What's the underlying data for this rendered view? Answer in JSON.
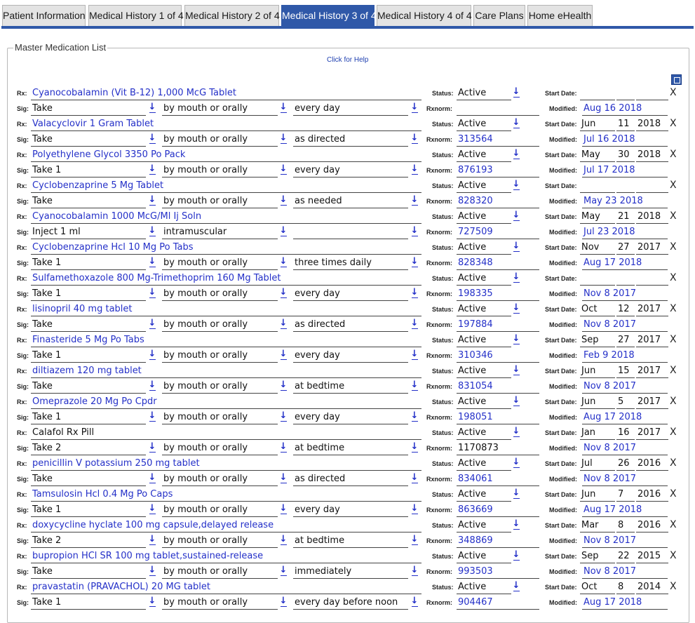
{
  "tabs": [
    {
      "label": "Patient Information",
      "active": false
    },
    {
      "label": "Medical History 1 of 4",
      "active": false
    },
    {
      "label": "Medical History 2 of 4",
      "active": false
    },
    {
      "label": "Medical History 3 of 4",
      "active": true
    },
    {
      "label": "Medical History 4 of 4",
      "active": false
    },
    {
      "label": "Care Plans",
      "active": false
    },
    {
      "label": "Home eHealth",
      "active": false
    }
  ],
  "panel": {
    "title": "Master Medication List",
    "help": "Click for Help"
  },
  "labels": {
    "rx": "Rx:",
    "sig": "Sig:",
    "status": "Status:",
    "rxnorm": "Rxnorm:",
    "start": "Start Date:",
    "modified": "Modified:",
    "remove": "X",
    "dropdown_icon": "down-arrow-icon"
  },
  "medications": [
    {
      "name": "Cyanocobalamin (Vit B-12) 1,000 McG Tablet",
      "linked": true,
      "sig_dose": "Take",
      "sig_route": "by mouth or orally",
      "sig_freq": "every day",
      "status": "Active",
      "rxnorm": "",
      "start_month": "",
      "start_day": "",
      "start_year": "",
      "modified": "Aug 16 2018"
    },
    {
      "name": "Valacyclovir 1 Gram Tablet",
      "linked": true,
      "sig_dose": "Take",
      "sig_route": "by mouth or orally",
      "sig_freq": "as directed",
      "status": "Active",
      "rxnorm": "313564",
      "start_month": "Jun",
      "start_day": "11",
      "start_year": "2018",
      "modified": "Jul 16 2018"
    },
    {
      "name": "Polyethylene Glycol 3350 Po Pack",
      "linked": true,
      "sig_dose": "Take 1",
      "sig_route": "by mouth or orally",
      "sig_freq": "every day",
      "status": "Active",
      "rxnorm": "876193",
      "start_month": "May",
      "start_day": "30",
      "start_year": "2018",
      "modified": "Jul 17 2018"
    },
    {
      "name": "Cyclobenzaprine 5 Mg Tablet",
      "linked": true,
      "sig_dose": "Take",
      "sig_route": "by mouth or orally",
      "sig_freq": "as needed",
      "status": "Active",
      "rxnorm": "828320",
      "start_month": "",
      "start_day": "",
      "start_year": "",
      "modified": "May 23 2018"
    },
    {
      "name": "Cyanocobalamin 1000 McG/Ml Ij Soln",
      "linked": true,
      "sig_dose": "Inject 1 ml",
      "sig_route": "intramuscular",
      "sig_freq": "",
      "status": "Active",
      "rxnorm": "727509",
      "start_month": "May",
      "start_day": "21",
      "start_year": "2018",
      "modified": "Jul 23 2018"
    },
    {
      "name": "Cyclobenzaprine Hcl 10 Mg Po Tabs",
      "linked": true,
      "sig_dose": "Take 1",
      "sig_route": "by mouth or orally",
      "sig_freq": "three times daily",
      "status": "Active",
      "rxnorm": "828348",
      "start_month": "Nov",
      "start_day": "27",
      "start_year": "2017",
      "modified": "Aug 17 2018"
    },
    {
      "name": "Sulfamethoxazole 800 Mg-Trimethoprim 160 Mg Tablet",
      "linked": true,
      "sig_dose": "Take 1",
      "sig_route": "by mouth or orally",
      "sig_freq": "every day",
      "status": "Active",
      "rxnorm": "198335",
      "start_month": "",
      "start_day": "",
      "start_year": "",
      "modified": "Nov 8 2017"
    },
    {
      "name": "lisinopril 40 mg tablet",
      "linked": true,
      "sig_dose": "Take",
      "sig_route": "by mouth or orally",
      "sig_freq": "as directed",
      "status": "Active",
      "rxnorm": "197884",
      "start_month": "Oct",
      "start_day": "12",
      "start_year": "2017",
      "modified": "Nov 8 2017"
    },
    {
      "name": "Finasteride 5 Mg Po Tabs",
      "linked": true,
      "sig_dose": "Take 1",
      "sig_route": "by mouth or orally",
      "sig_freq": "every day",
      "status": "Active",
      "rxnorm": "310346",
      "start_month": "Sep",
      "start_day": "27",
      "start_year": "2017",
      "modified": "Feb 9 2018"
    },
    {
      "name": "diltiazem 120 mg tablet",
      "linked": true,
      "sig_dose": "Take",
      "sig_route": "by mouth or orally",
      "sig_freq": "at bedtime",
      "status": "Active",
      "rxnorm": "831054",
      "start_month": "Jun",
      "start_day": "15",
      "start_year": "2017",
      "modified": "Nov 8 2017"
    },
    {
      "name": "Omeprazole 20 Mg Po Cpdr",
      "linked": true,
      "sig_dose": "Take 1",
      "sig_route": "by mouth or orally",
      "sig_freq": "every day",
      "status": "Active",
      "rxnorm": "198051",
      "start_month": "Jun",
      "start_day": "5",
      "start_year": "2017",
      "modified": "Aug 17 2018"
    },
    {
      "name": "Calafol Rx Pill",
      "linked": false,
      "sig_dose": "Take 2",
      "sig_route": "by mouth or orally",
      "sig_freq": "at bedtime",
      "status": "Active",
      "rxnorm": "1170873",
      "start_month": "Jan",
      "start_day": "16",
      "start_year": "2017",
      "modified": "Nov 8 2017"
    },
    {
      "name": "penicillin V potassium 250 mg tablet",
      "linked": true,
      "sig_dose": "Take",
      "sig_route": "by mouth or orally",
      "sig_freq": "as directed",
      "status": "Active",
      "rxnorm": "834061",
      "start_month": "Jul",
      "start_day": "26",
      "start_year": "2016",
      "modified": "Nov 8 2017"
    },
    {
      "name": "Tamsulosin Hcl 0.4 Mg Po Caps",
      "linked": true,
      "sig_dose": "Take 1",
      "sig_route": "by mouth or orally",
      "sig_freq": "every day",
      "status": "Active",
      "rxnorm": "863669",
      "start_month": "Jun",
      "start_day": "7",
      "start_year": "2016",
      "modified": "Aug 17 2018"
    },
    {
      "name": "doxycycline hyclate 100 mg capsule,delayed release",
      "linked": true,
      "sig_dose": "Take 2",
      "sig_route": "by mouth or orally",
      "sig_freq": "at bedtime",
      "status": "Active",
      "rxnorm": "348869",
      "start_month": "Mar",
      "start_day": "8",
      "start_year": "2016",
      "modified": "Nov 8 2017"
    },
    {
      "name": "bupropion HCl SR 100 mg tablet,sustained-release",
      "linked": true,
      "sig_dose": "Take",
      "sig_route": "by mouth or orally",
      "sig_freq": "immediately",
      "status": "Active",
      "rxnorm": "993503",
      "start_month": "Sep",
      "start_day": "22",
      "start_year": "2015",
      "modified": "Nov 8 2017"
    },
    {
      "name": "pravastatin (PRAVACHOL) 20 MG tablet",
      "linked": true,
      "sig_dose": "Take 1",
      "sig_route": "by mouth or orally",
      "sig_freq": "every day before noon",
      "status": "Active",
      "rxnorm": "904467",
      "start_month": "Oct",
      "start_day": "8",
      "start_year": "2014",
      "modified": "Aug 17 2018"
    }
  ]
}
